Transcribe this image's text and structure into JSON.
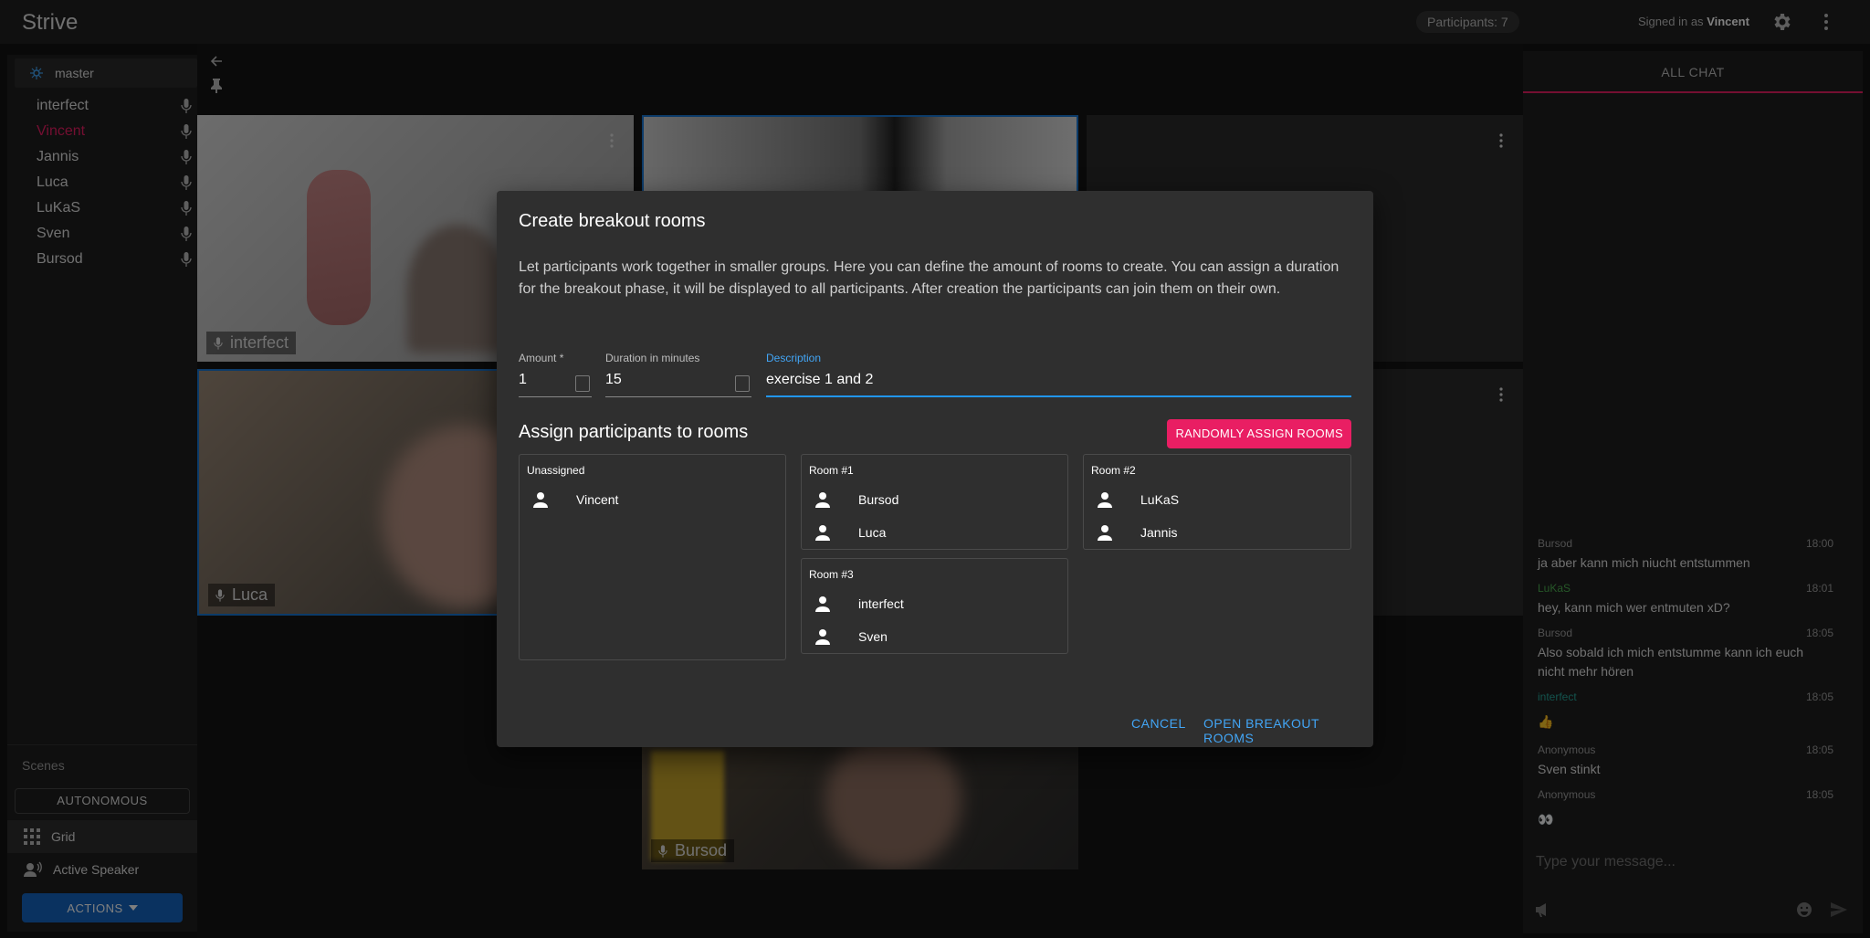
{
  "app": {
    "title": "Strive"
  },
  "header": {
    "participants_chip": "Participants: 7",
    "signed_in_prefix": "Signed in as",
    "signed_in_user": "Vincent"
  },
  "sidebar": {
    "room_name": "master",
    "participants": [
      {
        "name": "interfect"
      },
      {
        "name": "Vincent"
      },
      {
        "name": "Jannis"
      },
      {
        "name": "Luca"
      },
      {
        "name": "LuKaS"
      },
      {
        "name": "Sven"
      },
      {
        "name": "Bursod"
      }
    ],
    "scenes_label": "Scenes",
    "autonomous_label": "AUTONOMOUS",
    "scene_items": [
      {
        "label": "Grid"
      },
      {
        "label": "Active Speaker"
      }
    ],
    "actions_label": "ACTIONS"
  },
  "stage": {
    "tiles": [
      {
        "label": "interfect"
      },
      {
        "label": "Luca"
      },
      {
        "label": "Bursod"
      }
    ]
  },
  "dialog": {
    "title": "Create breakout rooms",
    "description": "Let participants work together in smaller groups. Here you can define the amount of rooms to create. You can assign a duration for the breakout phase, it will be displayed to all participants. After creation the participants can join them on their own.",
    "amount": {
      "label": "Amount *",
      "value": "1"
    },
    "duration": {
      "label": "Duration in minutes",
      "value": "15"
    },
    "desc_field": {
      "label": "Description",
      "value": "exercise 1 and 2"
    },
    "assign_title": "Assign participants to rooms",
    "random_button": "RANDOMLY ASSIGN ROOMS",
    "unassigned": {
      "title": "Unassigned",
      "members": [
        "Vincent"
      ]
    },
    "rooms": [
      {
        "title": "Room #1",
        "members": [
          "Bursod",
          "Luca"
        ]
      },
      {
        "title": "Room #2",
        "members": [
          "LuKaS",
          "Jannis"
        ]
      },
      {
        "title": "Room #3",
        "members": [
          "interfect",
          "Sven"
        ]
      }
    ],
    "cancel_button": "CANCEL",
    "open_button": "OPEN BREAKOUT ROOMS"
  },
  "chat": {
    "tab_label": "ALL CHAT",
    "messages": [
      {
        "author": "Bursod",
        "time": "18:00",
        "text": "ja aber kann mich niucht entstummen"
      },
      {
        "author": "LuKaS",
        "time": "18:01",
        "text": "hey, kann mich wer entmuten xD?"
      },
      {
        "author": "Bursod",
        "time": "18:05",
        "text": "Also sobald ich mich entstumme kann ich euch nicht mehr hören"
      },
      {
        "author": "interfect",
        "time": "18:05",
        "text": "👍"
      },
      {
        "author": "Anonymous",
        "time": "18:05",
        "text": "Sven stinkt"
      },
      {
        "author": "Anonymous",
        "time": "18:05",
        "text": "👀"
      }
    ],
    "input_placeholder": "Type your message..."
  },
  "colors": {
    "accent": "#e91e63",
    "primary": "#1976d2",
    "link": "#42a5f5"
  }
}
